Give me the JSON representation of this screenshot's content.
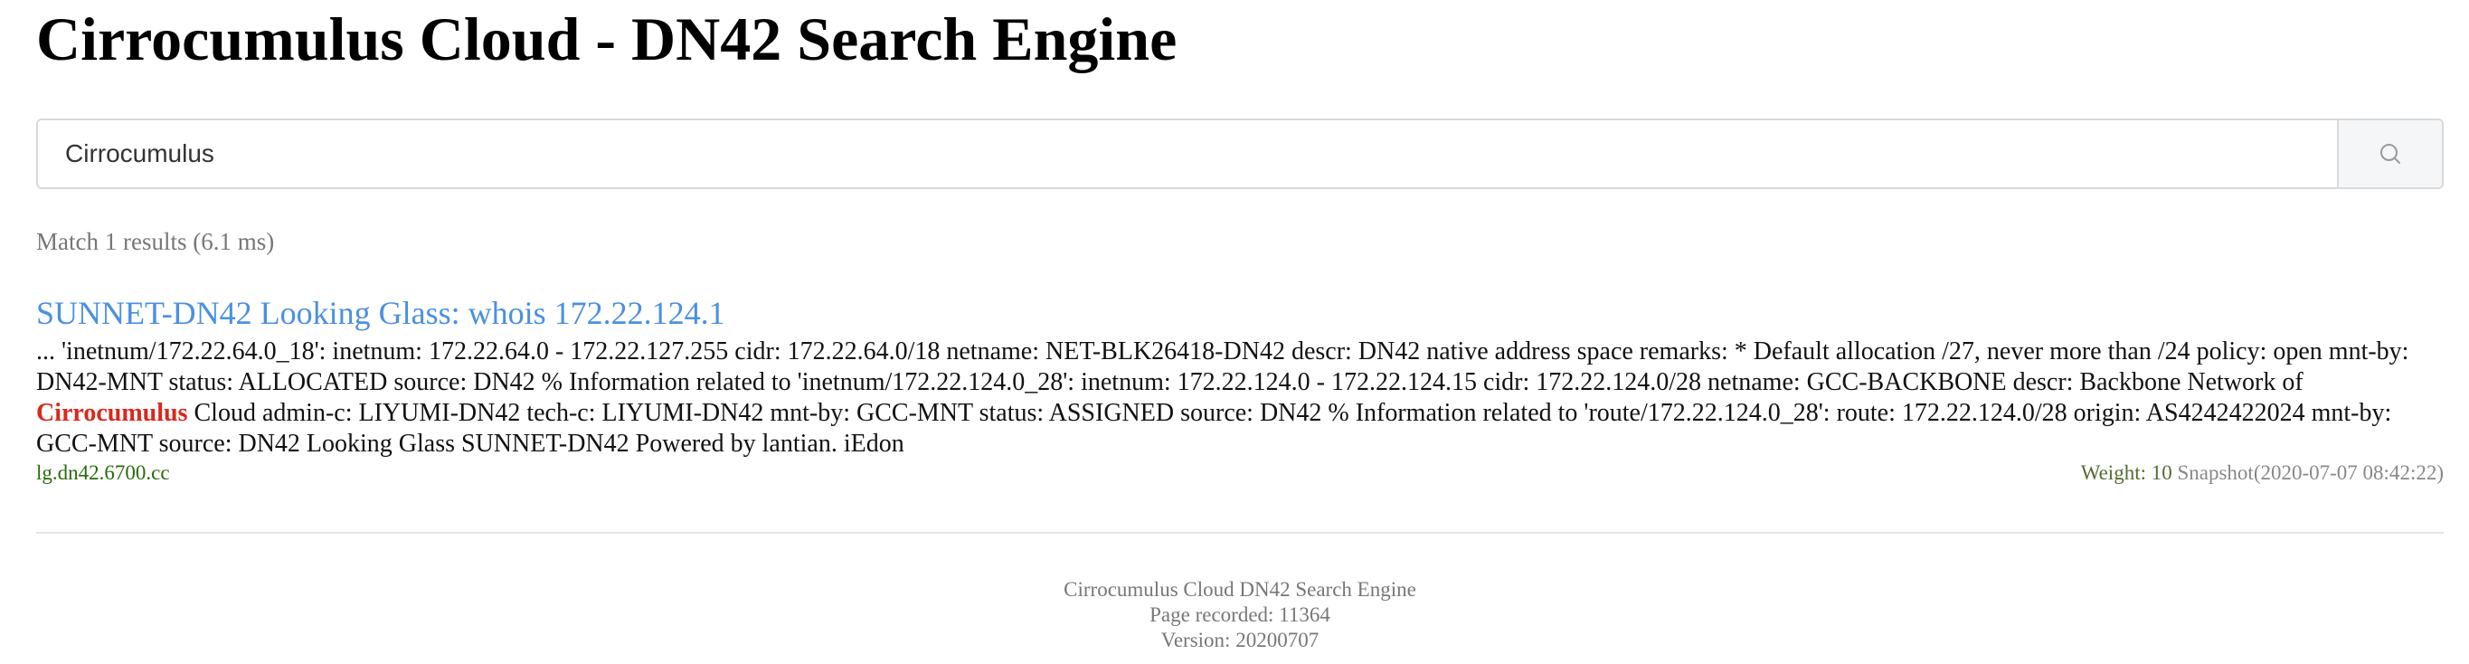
{
  "header": {
    "title": "Cirrocumulus Cloud - DN42 Search Engine"
  },
  "search": {
    "value": "Cirrocumulus",
    "placeholder": ""
  },
  "meta": {
    "match_text": "Match 1 results (6.1 ms)"
  },
  "results": [
    {
      "title": "SUNNET-DN42 Looking Glass: whois 172.22.124.1",
      "snippet_before": "... 'inetnum/172.22.64.0_18': inetnum: 172.22.64.0 - 172.22.127.255 cidr: 172.22.64.0/18 netname: NET-BLK26418-DN42 descr: DN42 native address space remarks: * Default allocation /27, never more than /24 policy: open mnt-by: DN42-MNT status: ALLOCATED source: DN42 % Information related to 'inetnum/172.22.124.0_28': inetnum: 172.22.124.0 - 172.22.124.15 cidr: 172.22.124.0/28 netname: GCC-BACKBONE descr: Backbone Network of ",
      "snippet_highlight": "Cirrocumulus",
      "snippet_after": " Cloud admin-c: LIYUMI-DN42 tech-c: LIYUMI-DN42 mnt-by: GCC-MNT status: ASSIGNED source: DN42 % Information related to 'route/172.22.124.0_28': route: 172.22.124.0/28 origin: AS4242422024 mnt-by: GCC-MNT source: DN42 Looking Glass SUNNET-DN42 Powered by lantian. iEdon",
      "host": "lg.dn42.6700.cc",
      "weight": "Weight: 10",
      "snapshot": "Snapshot(2020-07-07 08:42:22)"
    }
  ],
  "footer": {
    "line1": "Cirrocumulus Cloud DN42 Search Engine",
    "line2": "Page recorded: 11364",
    "line3": "Version: 20200707"
  },
  "icons": {
    "search_button": "search-icon"
  },
  "colors": {
    "link": "#4a90e2",
    "highlight": "#d9281c",
    "host": "#2b6a0a",
    "muted": "#777777"
  }
}
